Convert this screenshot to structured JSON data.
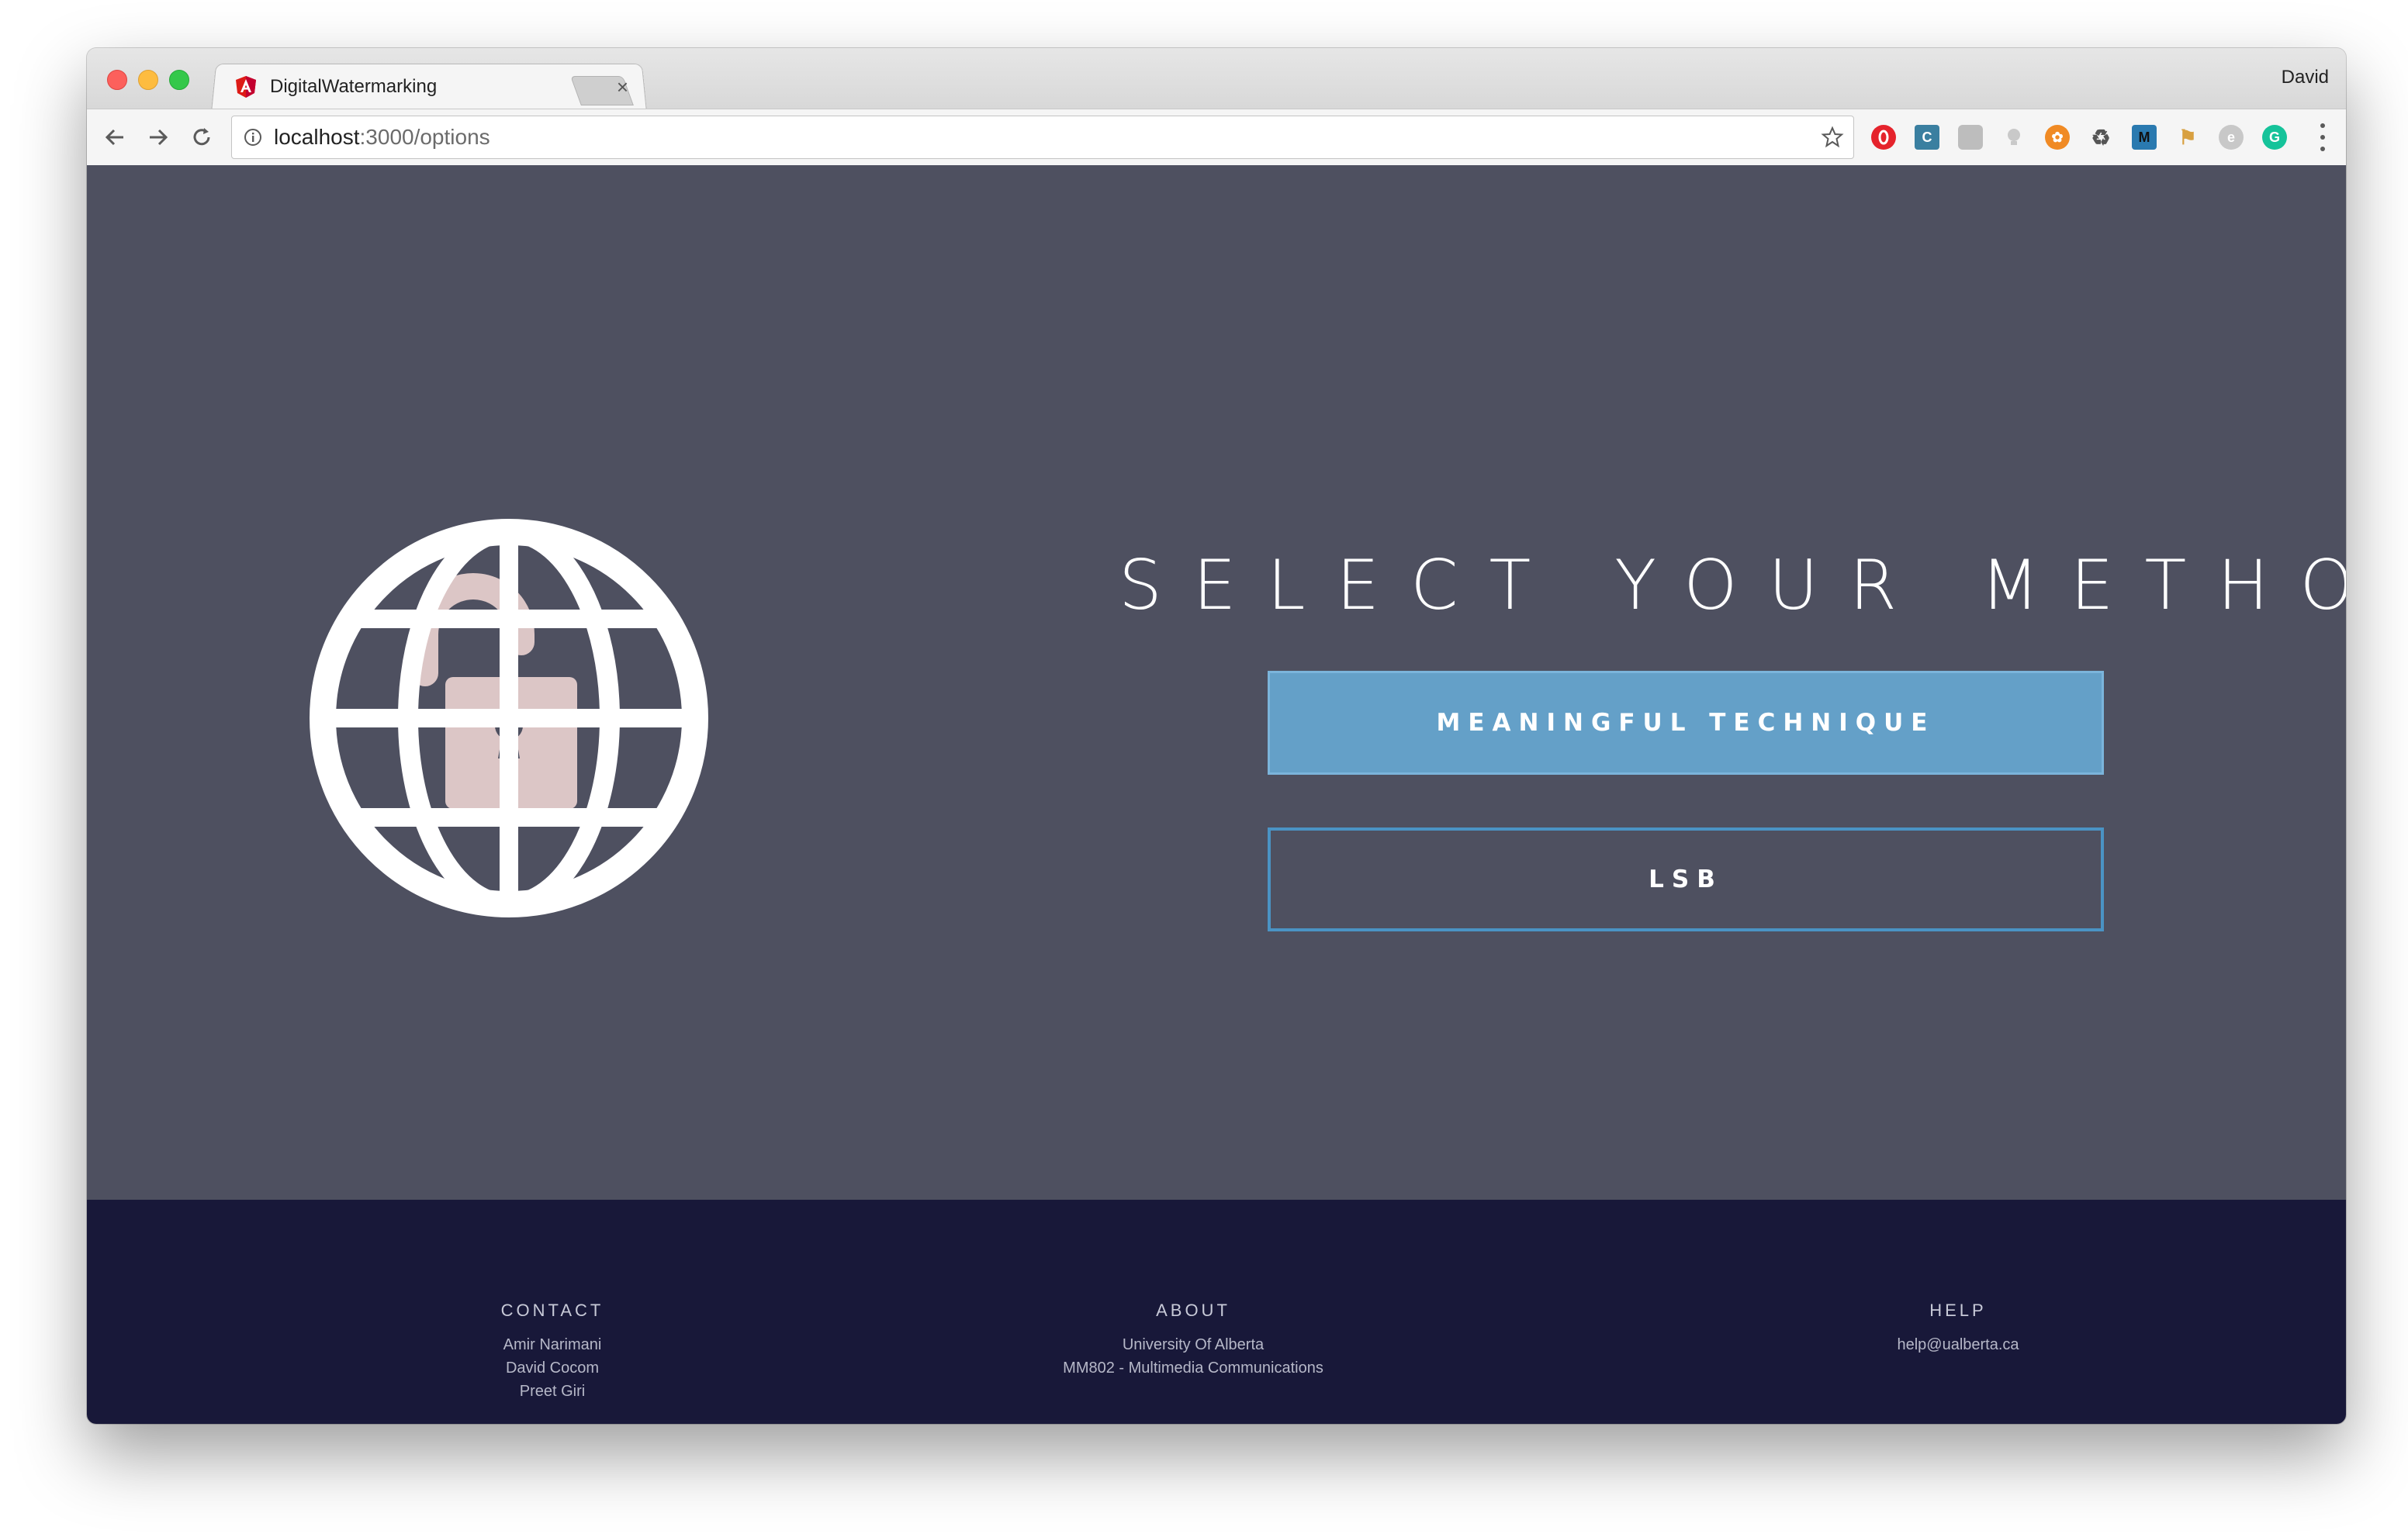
{
  "browser": {
    "tab_title": "DigitalWatermarking",
    "tab_close": "×",
    "profile_name": "David",
    "url_host": "localhost",
    "url_path": ":3000/options",
    "favicon": "angular-icon",
    "extensions": [
      "opera-icon",
      "extension-c-icon",
      "shield-icon",
      "bulb-icon",
      "orange-ext-icon",
      "recycle-icon",
      "m-icon",
      "flag-icon",
      "e-icon",
      "grammarly-icon"
    ]
  },
  "colors": {
    "page_bg": "#4e5060",
    "footer_bg": "#181839",
    "primary_button": "#64a0c8",
    "outline_button_border": "#4a93c4",
    "lock": "#dcc6c6"
  },
  "main": {
    "heading": "SELECT YOUR METHOD",
    "primary_button": "MEANINGFUL TECHNIQUE",
    "secondary_button": "LSB",
    "illustration": "globe-with-unlocked-padlock-icon"
  },
  "footer": {
    "contact": {
      "title": "CONTACT",
      "lines": [
        "Amir Narimani",
        "David Cocom",
        "Preet Giri"
      ]
    },
    "about": {
      "title": "ABOUT",
      "lines": [
        "University Of Alberta",
        "MM802 - Multimedia Communications"
      ]
    },
    "help": {
      "title": "HELP",
      "lines": [
        "help@ualberta.ca"
      ]
    }
  }
}
